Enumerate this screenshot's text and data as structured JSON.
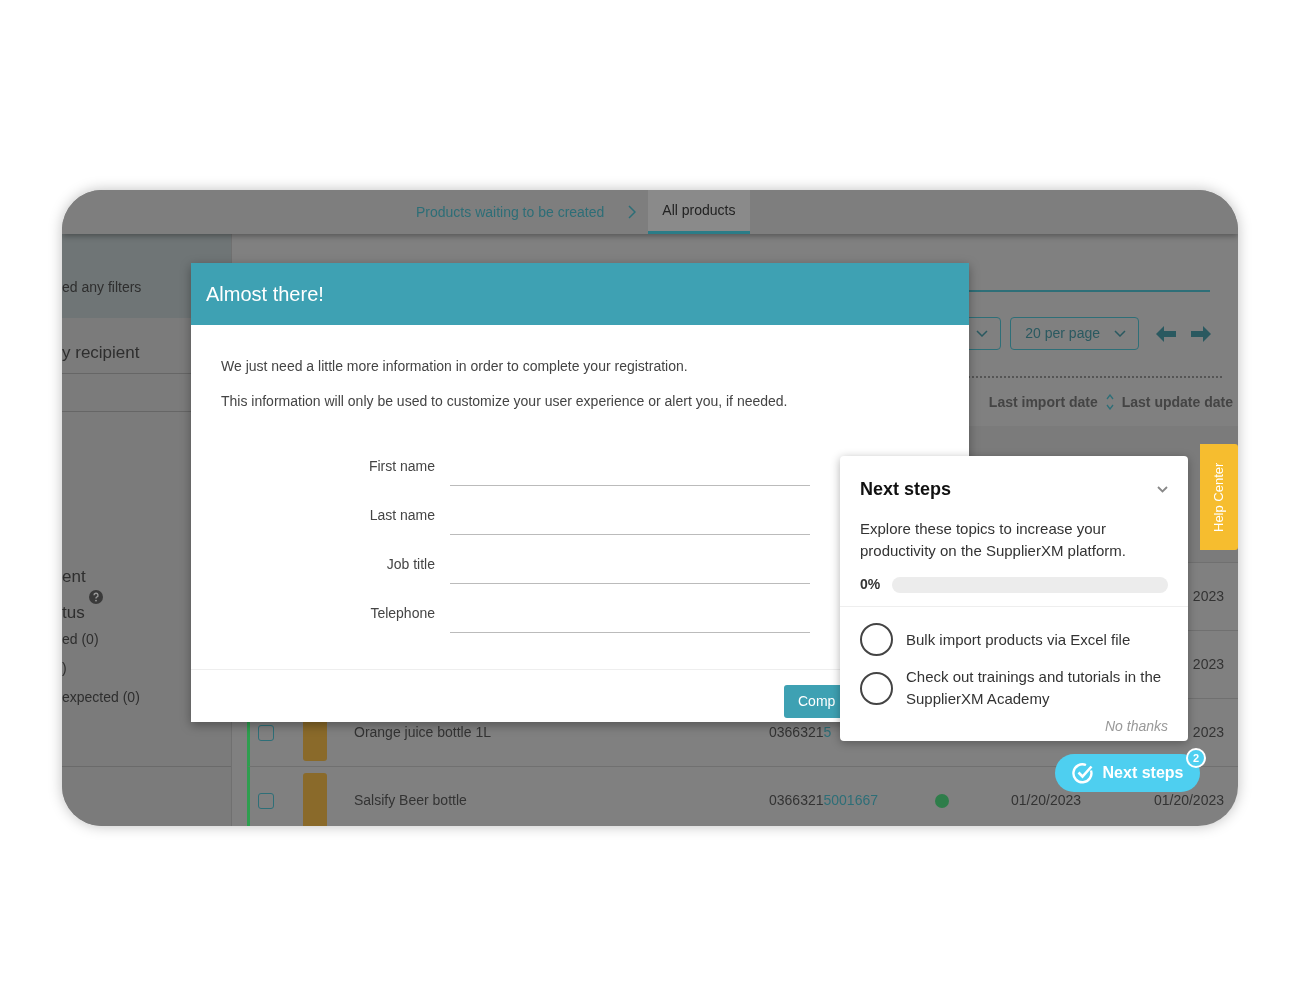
{
  "top_tabs": [
    {
      "label": "Products waiting to be created",
      "selected": false
    },
    {
      "label": "All products",
      "selected": true
    }
  ],
  "sidebar": {
    "filters_note": "ed any filters",
    "recipient": "y recipient",
    "section": "ent",
    "status_label": "tus",
    "status_options": [
      "ed (0)",
      ")",
      "expected (0)"
    ]
  },
  "toolbar": {
    "per_page": "20 per page"
  },
  "table": {
    "columns": [
      "Last import date",
      "Last update date"
    ],
    "rows": [
      {
        "update_date": "2023"
      },
      {
        "update_date": "2023"
      },
      {
        "name": "Orange juice bottle 1L",
        "checked": false,
        "barcode_prefix": "0366321",
        "barcode_suffix": "5",
        "update_date": "2023"
      },
      {
        "name": "Salsify Beer bottle",
        "checked": false,
        "barcode_prefix": "0366321",
        "barcode_suffix": "5001667",
        "color": "#2e7d4a",
        "import_date": "01/20/2023",
        "update_date": "01/20/2023"
      }
    ]
  },
  "modal": {
    "title": "Almost there!",
    "paragraphs": [
      "We just need a little more information in order to complete your registration.",
      "This information will only be used to customize your user experience or alert you, if needed."
    ],
    "fields": [
      {
        "label": "First name"
      },
      {
        "label": "Last name"
      },
      {
        "label": "Job title"
      },
      {
        "label": "Telephone"
      }
    ],
    "submit_button": "Comp"
  },
  "next_steps_panel": {
    "title": "Next steps",
    "description": "Explore these topics to increase your productivity on the SupplierXM platform.",
    "progress_text": "0%",
    "level": 0,
    "tasks": [
      {
        "label": "Bulk import products via Excel file",
        "checked": false
      },
      {
        "label": "Check out trainings and tutorials in the SupplierXM Academy",
        "checked": false
      }
    ],
    "dismiss": "No thanks"
  },
  "help_tab": "Help Center",
  "next_steps_button": {
    "label": "Next steps",
    "badge": "2"
  }
}
